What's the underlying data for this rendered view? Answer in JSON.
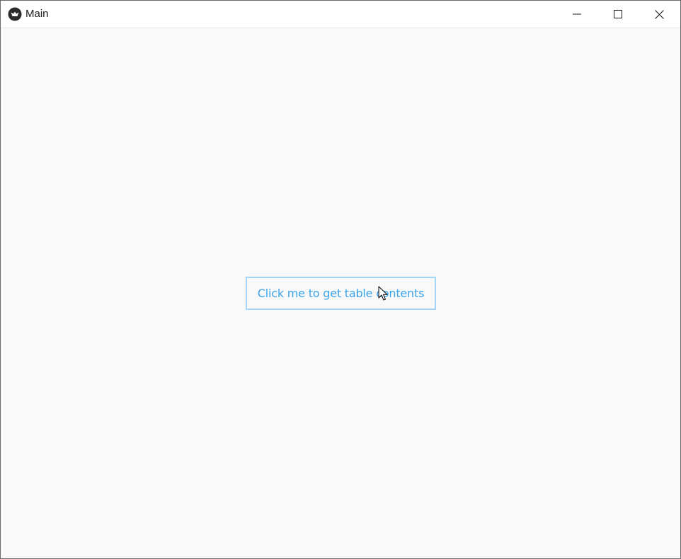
{
  "window": {
    "title": "Main",
    "app_icon": "kivy-logo-icon",
    "controls": {
      "minimize": "minimize-icon",
      "maximize": "maximize-icon",
      "close": "close-icon"
    }
  },
  "main": {
    "button_label": "Click me to get table contents"
  },
  "colors": {
    "button_text": "#3ba4ea",
    "button_border": "#a6d6f7",
    "background": "#f9f9f9"
  }
}
